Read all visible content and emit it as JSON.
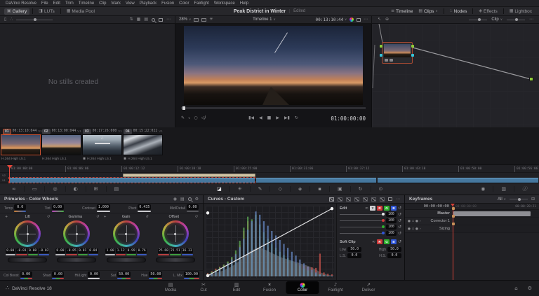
{
  "window": {
    "app_version": "DaVinci Resolve 18"
  },
  "menu": {
    "items": [
      "DaVinci Resolve",
      "File",
      "Edit",
      "Trim",
      "Timeline",
      "Clip",
      "Mark",
      "View",
      "Playback",
      "Fusion",
      "Color",
      "Fairlight",
      "Workspace",
      "Help"
    ]
  },
  "header": {
    "title": "Peak District in Winter",
    "status": "Edited",
    "left_buttons": [
      {
        "label": "Gallery"
      },
      {
        "label": "LUTs"
      },
      {
        "label": "Media Pool"
      }
    ],
    "right_buttons": [
      {
        "label": "Timeline"
      },
      {
        "label": "Clips"
      },
      {
        "label": "Nodes"
      },
      {
        "label": "Effects"
      },
      {
        "label": "Lightbox"
      }
    ]
  },
  "gallery": {
    "empty_text": "No stills created"
  },
  "viewer": {
    "zoom_level": "28%",
    "timeline_name": "Timeline 1",
    "source_timecode": "00:13:10:44",
    "record_timecode": "01:00:00:00"
  },
  "node_editor": {
    "mode": "Clip"
  },
  "clips": [
    {
      "index": "01",
      "timecode": "00:13:10:044",
      "track": "V1",
      "codec": "H.264 High L5.1"
    },
    {
      "index": "02",
      "timecode": "00:13:00:044",
      "track": "V1",
      "codec": "H.264 High L5.1"
    },
    {
      "index": "03",
      "timecode": "00:17:26:000",
      "track": "V1",
      "codec": "H.264 High L5.1"
    },
    {
      "index": "04",
      "timecode": "00:15:22:022",
      "track": "V1",
      "codec": "H.264 High L5.1"
    }
  ],
  "timeline": {
    "ticks": [
      "01:00:00:00",
      "01:00:06:06",
      "01:00:12:12",
      "01:00:18:18",
      "01:00:25:00",
      "01:00:31:06",
      "01:00:37:12",
      "01:00:43:18",
      "01:00:50:00",
      "01:00:56:06"
    ],
    "tracks": [
      "V2",
      "V1"
    ]
  },
  "primaries": {
    "title": "Primaries - Color Wheels",
    "params": [
      {
        "label": "Temp",
        "value": "0.0"
      },
      {
        "label": "Tint",
        "value": "0.00"
      },
      {
        "label": "Contrast",
        "value": "1.000"
      },
      {
        "label": "Pivot",
        "value": "0.435"
      },
      {
        "label": "Mid/Detail",
        "value": "0.00"
      }
    ],
    "wheels": [
      {
        "name": "Lift",
        "values": [
          "0.00",
          "-0.01",
          "0.00",
          "-0.02"
        ]
      },
      {
        "name": "Gamma",
        "values": [
          "0.00",
          "-0.05",
          "0.01",
          "0.04"
        ]
      },
      {
        "name": "Gain",
        "values": [
          "1.00",
          "1.12",
          "0.99",
          "0.76"
        ]
      },
      {
        "name": "Offset",
        "values": [
          "25.68",
          "21.51",
          "36.33"
        ]
      }
    ],
    "footer": [
      {
        "label": "Col Boost",
        "value": "0.00"
      },
      {
        "label": "Shad",
        "value": "0.00"
      },
      {
        "label": "Hi/Light",
        "value": "0.00"
      },
      {
        "label": "Sat",
        "value": "50.00"
      },
      {
        "label": "Hue",
        "value": "50.00"
      },
      {
        "label": "L. Mix",
        "value": "100.00"
      }
    ]
  },
  "curves": {
    "title": "Curves - Custom",
    "histogram": {
      "luma": [
        0.02,
        0.03,
        0.05,
        0.07,
        0.09,
        0.12,
        0.15,
        0.19,
        0.24,
        0.3,
        0.36,
        0.4,
        0.43,
        0.45,
        0.42,
        0.39,
        0.36,
        0.33,
        0.3,
        0.28,
        0.26,
        0.24,
        0.22,
        0.2,
        0.18,
        0.16,
        0.13,
        0.1,
        0.06,
        0.04,
        0.02,
        0.01
      ],
      "red": [
        0.05,
        0.08,
        0.12,
        0.15,
        0.18,
        0.22,
        0.28,
        0.35,
        0.48,
        0.7,
        0.85,
        0.82,
        0.85,
        0.62,
        0.52,
        0.45,
        0.38,
        0.32,
        0.28,
        0.25,
        0.23,
        0.21,
        0.19,
        0.17,
        0.16,
        0.15,
        0.14,
        0.13,
        0.35,
        0.06,
        0.04,
        0.03
      ],
      "green": [
        0.04,
        0.07,
        0.1,
        0.14,
        0.18,
        0.23,
        0.3,
        0.4,
        0.55,
        0.75,
        0.92,
        0.88,
        0.95,
        0.8,
        0.68,
        0.58,
        0.5,
        0.44,
        0.38,
        0.33,
        0.28,
        0.24,
        0.2,
        0.16,
        0.12,
        0.09,
        0.06,
        0.04,
        0.03,
        0.02,
        0.01,
        0.01
      ],
      "blue": [
        0.03,
        0.05,
        0.08,
        0.11,
        0.15,
        0.2,
        0.26,
        0.34,
        0.45,
        0.58,
        0.72,
        0.85,
        1.0,
        0.95,
        0.85,
        0.78,
        0.7,
        0.63,
        0.56,
        0.5,
        0.44,
        0.38,
        0.32,
        0.26,
        0.2,
        0.15,
        0.1,
        0.06,
        0.03,
        0.02,
        0.01,
        0.01
      ]
    }
  },
  "edit_panel": {
    "title": "Edit",
    "channels": [
      "Y",
      "R",
      "G",
      "B"
    ],
    "slider_values": [
      "100",
      "100",
      "100",
      "100"
    ],
    "soft_clip": {
      "title": "Soft Clip",
      "channels": [
        "R",
        "G",
        "B"
      ],
      "fields": [
        {
          "label": "Low",
          "value": "50.0"
        },
        {
          "label": "High",
          "value": "50.0"
        },
        {
          "label": "L.S.",
          "value": "0.0"
        },
        {
          "label": "H.S.",
          "value": "0.0"
        }
      ]
    }
  },
  "keyframes": {
    "title": "Keyframes",
    "filter": "All",
    "current_timecode": "00:00:00:00",
    "ruler_ticks": [
      "00:00:00:00",
      "00:00:28:21"
    ],
    "rows": [
      {
        "label": "Master"
      },
      {
        "label": "Corrector 1"
      },
      {
        "label": "Sizing"
      }
    ]
  },
  "pages": [
    {
      "label": "Media"
    },
    {
      "label": "Cut"
    },
    {
      "label": "Edit"
    },
    {
      "label": "Fusion"
    },
    {
      "label": "Color",
      "active": true
    },
    {
      "label": "Fairlight"
    },
    {
      "label": "Deliver"
    }
  ],
  "colors": {
    "accent_orange": "#c8502e",
    "clip_blue": "#46789f",
    "playhead_red": "#e5483c",
    "node_green": "#8ecc3a",
    "node_cyan": "#35c3d8"
  },
  "icons": {
    "gallery": "▣",
    "luts": "◨",
    "media_pool": "▦",
    "timeline_btn": "≡",
    "clips_btn": "▤",
    "nodes_btn": "∴",
    "effects_btn": "◈",
    "lightbox_btn": "▦",
    "chevron": "∨",
    "dots": "⋯",
    "stills_panel": "▯",
    "album_tree": "∴",
    "sort": "⇅",
    "grid_view": "▦",
    "list_view": "▤",
    "wand": "✳",
    "pointer": "↖",
    "grab": "⊕",
    "pen": "✎",
    "compare": "○",
    "skip_start": "▮◀",
    "step_back": "◀",
    "stop": "■",
    "play": "▶",
    "skip_end": "▶▮",
    "loop": "↻",
    "camera": "▪",
    "overlay_node": "∴",
    "reset": "↺",
    "link": "∞",
    "cross": "+",
    "auto_balance": "◉",
    "presets": "▤",
    "settings": "⚙",
    "tools_left": [
      "∞",
      "▭",
      "◎",
      "◐",
      "⊞",
      "▤"
    ],
    "tools_center": [
      "◪",
      "✳",
      "✎",
      "◇",
      "◈",
      "▪",
      "▣",
      "↻",
      "⊙"
    ],
    "tools_right": [
      "◉",
      "▥",
      "ⓘ"
    ],
    "enable_dot": "●",
    "lock": "▫",
    "solo": "●",
    "chev_right": "›",
    "add_box": "⊞",
    "home": "⌂",
    "gear": "⚙",
    "logo": "∴",
    "tab_icons": [
      "▤",
      "✂",
      "▥",
      "✶",
      "",
      "♪",
      "↗"
    ]
  }
}
